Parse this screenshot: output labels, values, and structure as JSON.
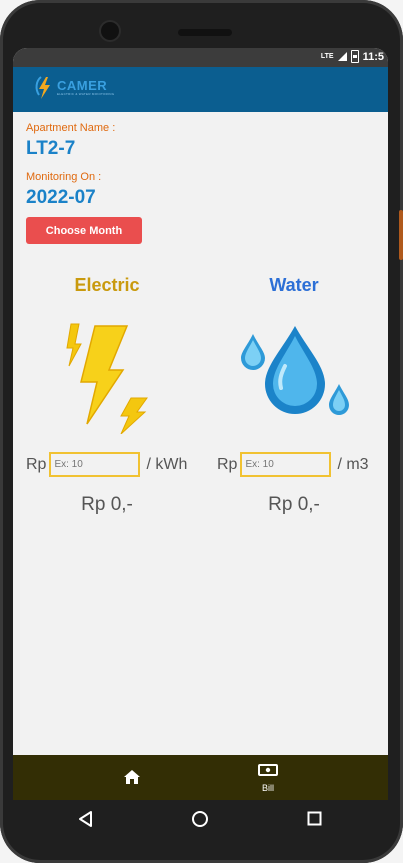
{
  "status": {
    "network": "LTE",
    "time": "11:5"
  },
  "app": {
    "logo_text": "CAMER",
    "logo_subtext": "ELECTRIC & WATER MONITORING"
  },
  "apartment": {
    "label": "Apartment Name :",
    "value": "LT2-7"
  },
  "monitoring": {
    "label": "Monitoring On :",
    "value": "2022-07"
  },
  "choose_month_label": "Choose Month",
  "electric": {
    "title": "Electric",
    "currency": "Rp",
    "placeholder": "Ex: 10",
    "unit": "/ kWh",
    "total": "Rp 0,-",
    "icon": "lightning-icon",
    "color": "#c99a0e"
  },
  "water": {
    "title": "Water",
    "currency": "Rp",
    "placeholder": "Ex: 10",
    "unit": "/ m3",
    "total": "Rp 0,-",
    "icon": "water-drops-icon",
    "color": "#2c6fd6"
  },
  "nav": {
    "items": [
      {
        "label": "",
        "icon": "home-icon",
        "active": true
      },
      {
        "label": "Bill",
        "icon": "bill-icon",
        "active": false
      }
    ]
  },
  "colors": {
    "appbar": "#0b5e90",
    "bottom_nav": "#332e05",
    "label_orange": "#e06a10",
    "value_blue": "#1b82c8",
    "button_red": "#ea4e4e",
    "input_border": "#f1c232"
  }
}
